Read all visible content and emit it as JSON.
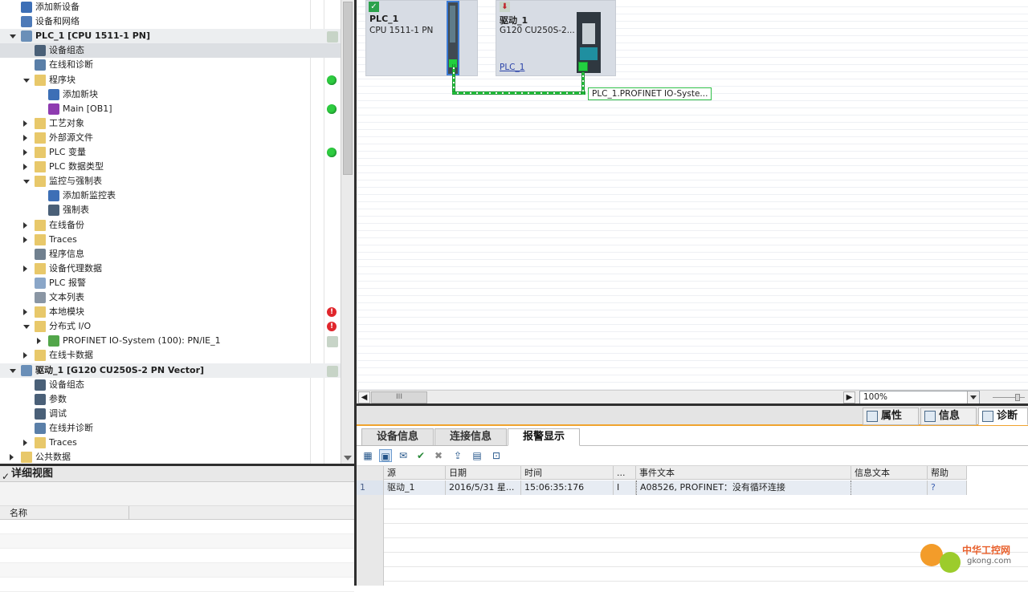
{
  "project_tree": {
    "rows": [
      {
        "label": "添加新设备",
        "indent": 0,
        "icon": "add-device-icon",
        "arrow": "none",
        "status": ""
      },
      {
        "label": "设备和网络",
        "indent": 0,
        "icon": "network-icon",
        "arrow": "none",
        "status": ""
      },
      {
        "label": "PLC_1 [CPU 1511-1 PN]",
        "indent": 0,
        "icon": "plc-icon",
        "arrow": "open",
        "status": "download",
        "device": true
      },
      {
        "label": "设备组态",
        "indent": 1,
        "icon": "device-config-icon",
        "arrow": "none",
        "status": "",
        "selected": true
      },
      {
        "label": "在线和诊断",
        "indent": 1,
        "icon": "online-diag-icon",
        "arrow": "none",
        "status": ""
      },
      {
        "label": "程序块",
        "indent": 1,
        "icon": "folder-icon",
        "arrow": "open",
        "status": "ok"
      },
      {
        "label": "添加新块",
        "indent": 2,
        "icon": "add-block-icon",
        "arrow": "none",
        "status": ""
      },
      {
        "label": "Main [OB1]",
        "indent": 2,
        "icon": "ob-icon",
        "arrow": "none",
        "status": "ok"
      },
      {
        "label": "工艺对象",
        "indent": 1,
        "icon": "folder-icon",
        "arrow": "closed",
        "status": ""
      },
      {
        "label": "外部源文件",
        "indent": 1,
        "icon": "folder-icon",
        "arrow": "closed",
        "status": ""
      },
      {
        "label": "PLC 变量",
        "indent": 1,
        "icon": "folder-icon",
        "arrow": "closed",
        "status": "ok"
      },
      {
        "label": "PLC 数据类型",
        "indent": 1,
        "icon": "folder-icon",
        "arrow": "closed",
        "status": ""
      },
      {
        "label": "监控与强制表",
        "indent": 1,
        "icon": "folder-icon",
        "arrow": "open",
        "status": ""
      },
      {
        "label": "添加新监控表",
        "indent": 2,
        "icon": "add-watch-icon",
        "arrow": "none",
        "status": ""
      },
      {
        "label": "强制表",
        "indent": 2,
        "icon": "force-table-icon",
        "arrow": "none",
        "status": ""
      },
      {
        "label": "在线备份",
        "indent": 1,
        "icon": "folder-icon",
        "arrow": "closed",
        "status": ""
      },
      {
        "label": "Traces",
        "indent": 1,
        "icon": "folder-icon",
        "arrow": "closed",
        "status": ""
      },
      {
        "label": "程序信息",
        "indent": 1,
        "icon": "program-info-icon",
        "arrow": "none",
        "status": ""
      },
      {
        "label": "设备代理数据",
        "indent": 1,
        "icon": "folder-icon",
        "arrow": "closed",
        "status": ""
      },
      {
        "label": "PLC 报警",
        "indent": 1,
        "icon": "mail-icon",
        "arrow": "none",
        "status": ""
      },
      {
        "label": "文本列表",
        "indent": 1,
        "icon": "text-list-icon",
        "arrow": "none",
        "status": ""
      },
      {
        "label": "本地模块",
        "indent": 1,
        "icon": "folder-icon",
        "arrow": "closed",
        "status": "error"
      },
      {
        "label": "分布式 I/O",
        "indent": 1,
        "icon": "folder-icon",
        "arrow": "open",
        "status": "error"
      },
      {
        "label": "PROFINET IO-System (100): PN/IE_1",
        "indent": 2,
        "icon": "io-system-icon",
        "arrow": "closed",
        "status": "download"
      },
      {
        "label": "在线卡数据",
        "indent": 1,
        "icon": "folder-icon",
        "arrow": "closed",
        "status": ""
      },
      {
        "label": "驱动_1 [G120 CU250S-2 PN Vector]",
        "indent": 0,
        "icon": "drive-icon",
        "arrow": "open",
        "status": "download",
        "device": true
      },
      {
        "label": "设备组态",
        "indent": 1,
        "icon": "device-config-icon",
        "arrow": "none",
        "status": ""
      },
      {
        "label": "参数",
        "indent": 1,
        "icon": "params-icon",
        "arrow": "none",
        "status": ""
      },
      {
        "label": "调试",
        "indent": 1,
        "icon": "commissioning-icon",
        "arrow": "none",
        "status": ""
      },
      {
        "label": "在线并诊断",
        "indent": 1,
        "icon": "online-diag-icon",
        "arrow": "none",
        "status": ""
      },
      {
        "label": "Traces",
        "indent": 1,
        "icon": "folder-icon",
        "arrow": "closed",
        "status": ""
      },
      {
        "label": "公共数据",
        "indent": 0,
        "icon": "folder-icon",
        "arrow": "closed",
        "status": ""
      }
    ]
  },
  "details_view": {
    "title": "详细视图",
    "column_name": "名称"
  },
  "network_view": {
    "plc": {
      "name": "PLC_1",
      "type": "CPU 1511-1 PN"
    },
    "drive": {
      "name": "驱动_1",
      "type": "G120 CU250S-2...",
      "link": "PLC_1"
    },
    "io_system_label": "PLC_1.PROFINET IO-Syste...",
    "zoom": "100%",
    "scroll_thumb": "III"
  },
  "inspector_tabs": [
    {
      "label": "属性",
      "icon": "properties-icon"
    },
    {
      "label": "信息",
      "icon": "info-icon"
    },
    {
      "label": "诊断",
      "icon": "diagnostics-icon",
      "active": true
    }
  ],
  "diag_tabs": [
    {
      "label": "设备信息"
    },
    {
      "label": "连接信息"
    },
    {
      "label": "报警显示",
      "active": true
    }
  ],
  "alarm_table": {
    "headers": [
      "源",
      "日期",
      "时间",
      "...",
      "事件文本",
      "信息文本",
      "帮助"
    ],
    "rows": [
      {
        "num": "1",
        "source": "驱动_1",
        "date": "2016/5/31 星...",
        "time": "15:06:35:176",
        "state": "I",
        "event": "A08526, PROFINET：没有循环连接",
        "info": "",
        "help": "?"
      }
    ]
  },
  "watermark": {
    "brand": "中华工控网",
    "domain": "gkong.com"
  },
  "colors": {
    "accent_orange": "#f0a32e",
    "ok_green": "#2ecc40",
    "error_red": "#e0262c",
    "network_green": "#22c43a"
  }
}
